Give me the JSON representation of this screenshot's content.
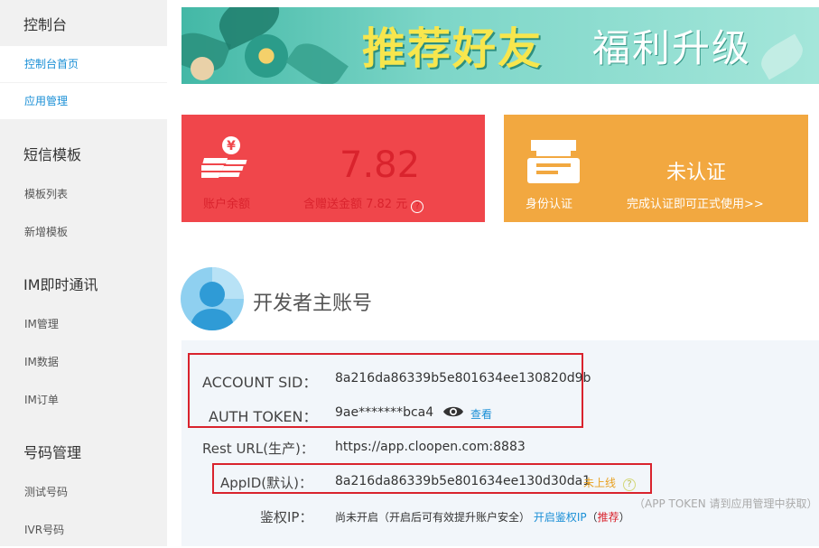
{
  "sidebar": {
    "console_header": "控制台",
    "console_home": "控制台首页",
    "app_manage": "应用管理",
    "sms_header": "短信模板",
    "template_list": "模板列表",
    "new_template": "新增模板",
    "im_header": "IM即时通讯",
    "im_manage": "IM管理",
    "im_data": "IM数据",
    "im_orders": "IM订单",
    "number_header": "号码管理",
    "test_number": "测试号码",
    "ivr_number": "IVR号码"
  },
  "banner": {
    "main": "推荐好友",
    "sub": "福利升级"
  },
  "balance_card": {
    "label": "账户余额",
    "amount": "7.82",
    "note": "含赠送金额 7.82 元",
    "help": "?",
    "color": "#f0464b"
  },
  "cert_card": {
    "label": "身份认证",
    "status": "未认证",
    "link": "完成认证即可正式使用>>",
    "color": "#f2a840"
  },
  "developer": {
    "title": "开发者主账号",
    "account_sid_label": "ACCOUNT SID：",
    "account_sid": "8a216da86339b5e801634ee130820d9b",
    "auth_token_label": "AUTH TOKEN：",
    "auth_token": "9ae*******bca4",
    "view_label": "查看",
    "rest_url_label": "Rest URL(生产)：",
    "rest_url": "https://app.cloopen.com:8883",
    "appid_label": "AppID(默认)：",
    "appid": "8a216da86339b5e801634ee130d30da1",
    "appid_status": "未上线",
    "auth_ip_label": "鉴权IP：",
    "auth_ip_status": "尚未开启（开启后可有效提升账户安全）",
    "auth_ip_link": "开启鉴权IP",
    "auth_ip_recommend_open": "（",
    "auth_ip_recommend": "推荐",
    "auth_ip_recommend_close": "）",
    "app_token_note": "（APP TOKEN 请到应用管理中获取）"
  }
}
